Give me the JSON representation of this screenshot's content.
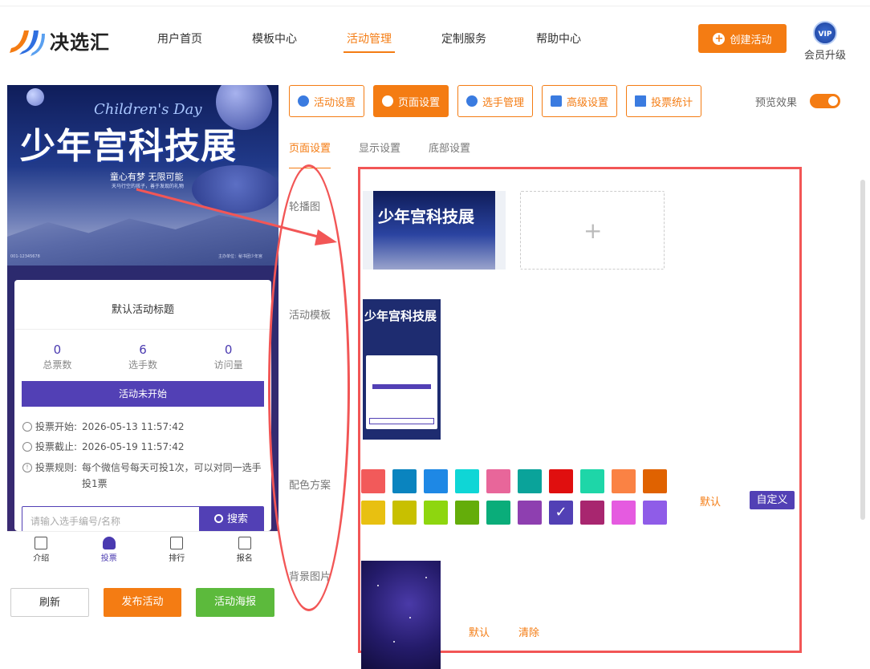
{
  "app": {
    "logo_text": "决选汇"
  },
  "nav": {
    "items": [
      "用户首页",
      "模板中心",
      "活动管理",
      "定制服务",
      "帮助中心"
    ],
    "active": 2
  },
  "header": {
    "create_label": "创建活动",
    "vip_badge": "VIP",
    "vip_label": "会员升级"
  },
  "preview": {
    "banner_sub": "Children's Day",
    "banner_title": "少年宫科技展",
    "banner_slogan": "童心有梦 无限可能",
    "banner_slogan2": "天马行空的孩子，善于发现的礼物",
    "banner_foot_left": "001-12345678",
    "banner_foot_right": "主办单位：秘书团少年宫",
    "card_title": "默认活动标题",
    "stats": [
      {
        "value": "0",
        "label": "总票数"
      },
      {
        "value": "6",
        "label": "选手数"
      },
      {
        "value": "0",
        "label": "访问量"
      }
    ],
    "status": "活动未开始",
    "vote_start_label": "投票开始:",
    "vote_start": "2026-05-13 11:57:42",
    "vote_end_label": "投票截止:",
    "vote_end": "2026-05-19 11:57:42",
    "rule_label": "投票规则:",
    "rule_line1": "每个微信号每天可投1次，可以对同一选手",
    "rule_line2": "投1票",
    "search_placeholder": "请输入选手编号/名称",
    "search_button": "搜索",
    "tabs": [
      "介绍",
      "投票",
      "排行",
      "报名"
    ],
    "active_tab": 1
  },
  "bottom_buttons": {
    "refresh": "刷新",
    "publish": "发布活动",
    "poster": "活动海报"
  },
  "tools": [
    {
      "label": "活动设置",
      "icon": "star-icon"
    },
    {
      "label": "页面设置",
      "icon": "gear-icon"
    },
    {
      "label": "选手管理",
      "icon": "users-icon"
    },
    {
      "label": "高级设置",
      "icon": "sliders-icon"
    },
    {
      "label": "投票统计",
      "icon": "bar-chart-icon"
    }
  ],
  "active_tool": 1,
  "preview_toggle_label": "预览效果",
  "preview_toggle_on": true,
  "subtabs": [
    "页面设置",
    "显示设置",
    "底部设置"
  ],
  "active_subtab": 0,
  "rows": {
    "carousel": "轮播图",
    "template": "活动模板",
    "colors": "配色方案",
    "background": "背景图片"
  },
  "colors": [
    "#f25a5a",
    "#0a84bf",
    "#1e88e5",
    "#0fd6d6",
    "#e8669a",
    "#0aa39a",
    "#e00f0f",
    "#1ed6a8",
    "#fa8244",
    "#e06200",
    "#e8c011",
    "#c8c000",
    "#8ed60f",
    "#64ad0a",
    "#0aad7a",
    "#8e3fb0",
    "#5240b5",
    "#a8266f",
    "#e55be0",
    "#8f5ce8"
  ],
  "selected_color": 16,
  "color_default": "默认",
  "color_custom": "自定义",
  "bg_default": "默认",
  "bg_clear": "清除",
  "accent": "#f47c13",
  "theme": "#5240b5"
}
